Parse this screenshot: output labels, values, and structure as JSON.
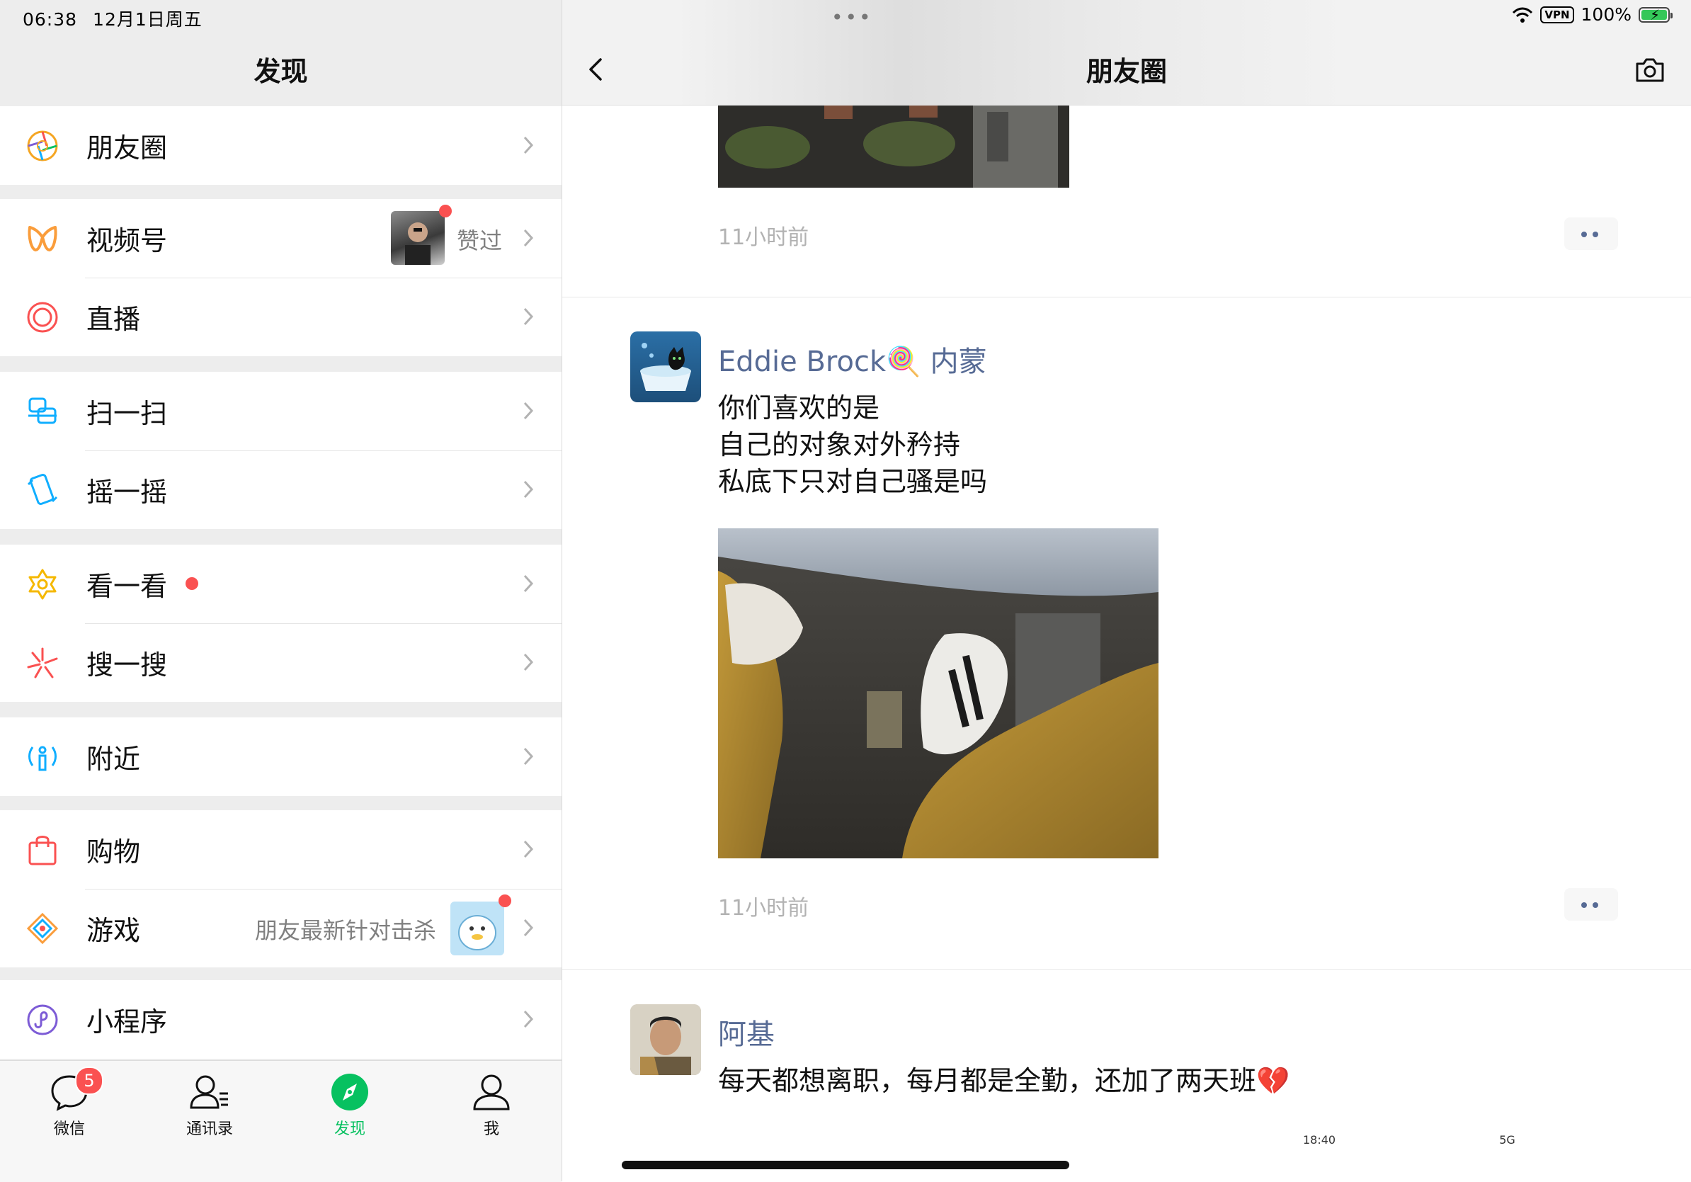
{
  "status_bar": {
    "time": "06:38",
    "date": "12月1日周五",
    "vpn": "VPN",
    "battery": "100%"
  },
  "discover": {
    "title": "发现",
    "items": [
      {
        "label": "朋友圈"
      },
      {
        "label": "视频号",
        "side_text": "赞过"
      },
      {
        "label": "直播"
      },
      {
        "label": "扫一扫"
      },
      {
        "label": "摇一摇"
      },
      {
        "label": "看一看"
      },
      {
        "label": "搜一搜"
      },
      {
        "label": "附近"
      },
      {
        "label": "购物"
      },
      {
        "label": "游戏",
        "side_text": "朋友最新针对击杀"
      },
      {
        "label": "小程序"
      }
    ]
  },
  "tab_bar": {
    "tabs": [
      {
        "label": "微信",
        "badge": "5"
      },
      {
        "label": "通讯录"
      },
      {
        "label": "发现",
        "active": true
      },
      {
        "label": "我"
      }
    ]
  },
  "moments": {
    "title": "朋友圈",
    "posts": [
      {
        "timestamp": "11小时前"
      },
      {
        "author": "Eddie Brock🍭 内蒙",
        "lines": [
          "你们喜欢的是",
          "自己的对象对外矜持",
          "私底下只对自己骚是吗"
        ],
        "timestamp": "11小时前"
      },
      {
        "author": "阿基",
        "text": "每天都想离职，每月都是全勤，还加了两天班💔",
        "peek_time": "18:40",
        "peek_signal": "5G"
      }
    ]
  },
  "colors": {
    "wechat_green": "#07c160",
    "link_blue": "#576b95",
    "badge_red": "#fa5151",
    "background_gray": "#ededed"
  }
}
